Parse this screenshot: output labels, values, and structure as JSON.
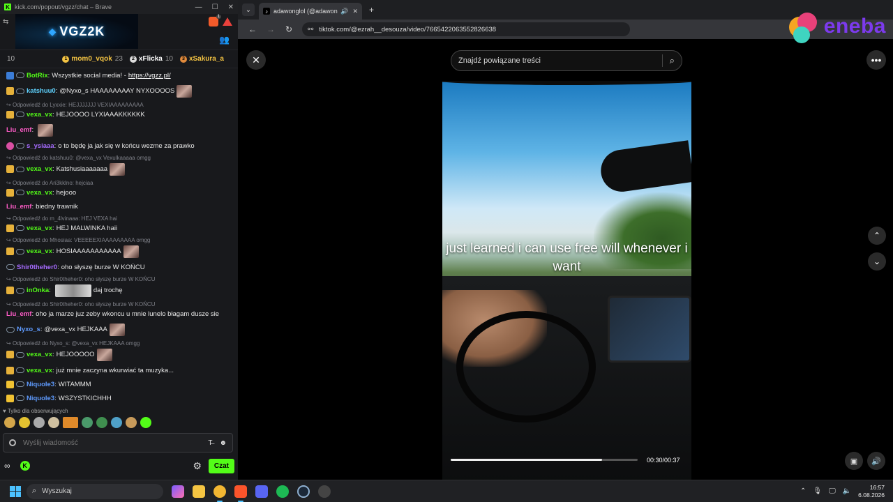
{
  "chat_window": {
    "title": "kick.com/popout/vgzz/chat – Brave",
    "banner_text": "VGZ2K",
    "viewer_count": "10",
    "top_gifters": [
      {
        "name": "mom0_vqok",
        "count": "23",
        "color": "#f3c343"
      },
      {
        "name": "xFlicka",
        "count": "10",
        "color": "#ffffff"
      },
      {
        "name": "xSakura_a",
        "count": "",
        "color": "#f3c343"
      }
    ],
    "messages": [
      {
        "reply": "",
        "user": "BotRix",
        "color": "#53fc18",
        "text": "Wszystkie social media! -",
        "link": "https://vgzz.pl/",
        "emote": false
      },
      {
        "reply": "",
        "user": "katshuu0",
        "color": "#5fd3ff",
        "text": "@Nyxo_s HAAAAAAAAY NYXOOOOS",
        "link": "",
        "emote": true
      },
      {
        "reply": "Odpowiedź do Lyxxie: HEJJJJJJJ VEXIAAAAAAAAA",
        "user": "vexa_vx",
        "color": "#53fc18",
        "text": "HEJOOOO LYXIAAAKKKKKK",
        "link": "",
        "emote": false
      },
      {
        "reply": "",
        "user": "Liu_emf",
        "color": "#ff5cc8",
        "text": "",
        "link": "",
        "emote": true
      },
      {
        "reply": "",
        "user": "s_ysiaaa",
        "color": "#a66bff",
        "text": "o to będę ja jak się w końcu wezme za prawko",
        "link": "",
        "emote": false
      },
      {
        "reply": "Odpowiedź do katshuu0: @vexa_vx Vexulkaaaaa omgg",
        "user": "vexa_vx",
        "color": "#53fc18",
        "text": "Katshusiaaaaaaa",
        "link": "",
        "emote": true
      },
      {
        "reply": "Odpowiedź do Ari3kklno: hejciaa",
        "user": "vexa_vx",
        "color": "#53fc18",
        "text": "hejooo",
        "link": "",
        "emote": false
      },
      {
        "reply": "",
        "user": "Liu_emf",
        "color": "#ff5cc8",
        "text": "biedny trawnik",
        "link": "",
        "emote": false
      },
      {
        "reply": "Odpowiedź do m_4lvinaaa: HEJ VEXA hai",
        "user": "vexa_vx",
        "color": "#53fc18",
        "text": "HEJ MALWINKA haii",
        "link": "",
        "emote": false
      },
      {
        "reply": "Odpowiedź do Mhosiaa: VEEEEEXIAAAAAAAAA omgg",
        "user": "vexa_vx",
        "color": "#53fc18",
        "text": "HOSIAAAAAAAAAAA",
        "link": "",
        "emote": true
      },
      {
        "reply": "",
        "user": "Shir0theher0",
        "color": "#a66bff",
        "text": "oho słyszę burze W KOŃCU",
        "link": "",
        "emote": false
      },
      {
        "reply": "Odpowiedź do Shir0theher0: oho słyszę burze W KOŃCU",
        "user": "inOnka",
        "color": "#53fc18",
        "text": "daj trochę",
        "link": "",
        "emote": false,
        "wide_emote": true
      },
      {
        "reply": "Odpowiedź do Shir0theher0: oho słyszę burze W KOŃCU",
        "user": "Liu_emf",
        "color": "#ff5cc8",
        "text": "oho ja marze juz zeby wkoncu u mnie lunelo błagam dusze sie",
        "link": "",
        "emote": false
      },
      {
        "reply": "",
        "user": "Nyxo_s",
        "color": "#5f9bff",
        "text": "@vexa_vx HEJKAAA",
        "link": "",
        "emote": true
      },
      {
        "reply": "Odpowiedź do Nyxo_s: @vexa_vx HEJKAAA omgg",
        "user": "vexa_vx",
        "color": "#53fc18",
        "text": "HEJOOOOO",
        "link": "",
        "emote": true
      },
      {
        "reply": "",
        "user": "vexa_vx",
        "color": "#53fc18",
        "text": "już mnie zaczyna wkurwiać ta muzyka...",
        "link": "",
        "emote": false
      },
      {
        "reply": "",
        "user": "Niquole3",
        "color": "#5f9bff",
        "text": "WITAMMM",
        "link": "",
        "emote": false
      },
      {
        "reply": "",
        "user": "Niquole3",
        "color": "#5f9bff",
        "text": "WSZYSTKICHHH",
        "link": "",
        "emote": false
      }
    ],
    "followers_only": "Tylko dla obserwujących",
    "input_placeholder": "Wyślij wiadomość",
    "send_label": "Czat"
  },
  "browser": {
    "tab_title": "adawonglol (@adawonglol)",
    "url": "tiktok.com/@ezrah__desouza/video/7665422063552826638",
    "search_placeholder": "Znajdź powiązane treści",
    "video_caption": "just learned i can use free will whenever i want",
    "video_time": "00:30/00:37",
    "video_progress": 0.81,
    "ad_brand": "eneba"
  },
  "taskbar": {
    "search_label": "Wyszukaj",
    "time": "16:57",
    "date": "6.08.2026"
  }
}
